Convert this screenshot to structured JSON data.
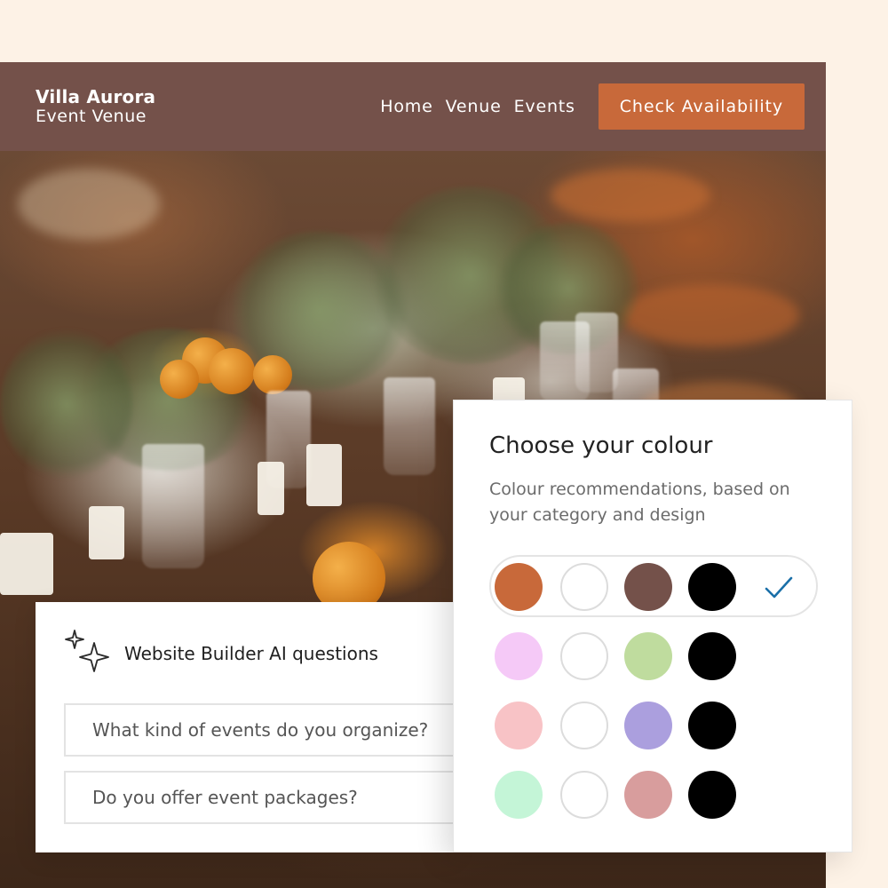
{
  "site": {
    "brand_name": "Villa Aurora",
    "brand_tagline": "Event Venue",
    "nav": [
      "Home",
      "Venue",
      "Events"
    ],
    "cta_label": "Check Availability",
    "colors": {
      "header": "#74514a",
      "cta": "#c8693a"
    }
  },
  "ai_questions": {
    "title": "Website Builder AI questions",
    "icon": "sparkle-icon",
    "questions": [
      "What kind of events do you organize?",
      "Do you offer event packages?"
    ]
  },
  "colour_picker": {
    "title": "Choose your colour",
    "subtitle": "Colour recommendations, based on your category and design",
    "selected_row": 0,
    "palettes": [
      [
        "#c8693a",
        "#ffffff",
        "#74514a",
        "#000000"
      ],
      [
        "#f5c9f7",
        "#ffffff",
        "#bfdc9e",
        "#000000"
      ],
      [
        "#f8c3c6",
        "#ffffff",
        "#ab9fde",
        "#000000"
      ],
      [
        "#c4f5d7",
        "#ffffff",
        "#d89d9d",
        "#000000"
      ]
    ],
    "check_color": "#1a6fa8"
  }
}
